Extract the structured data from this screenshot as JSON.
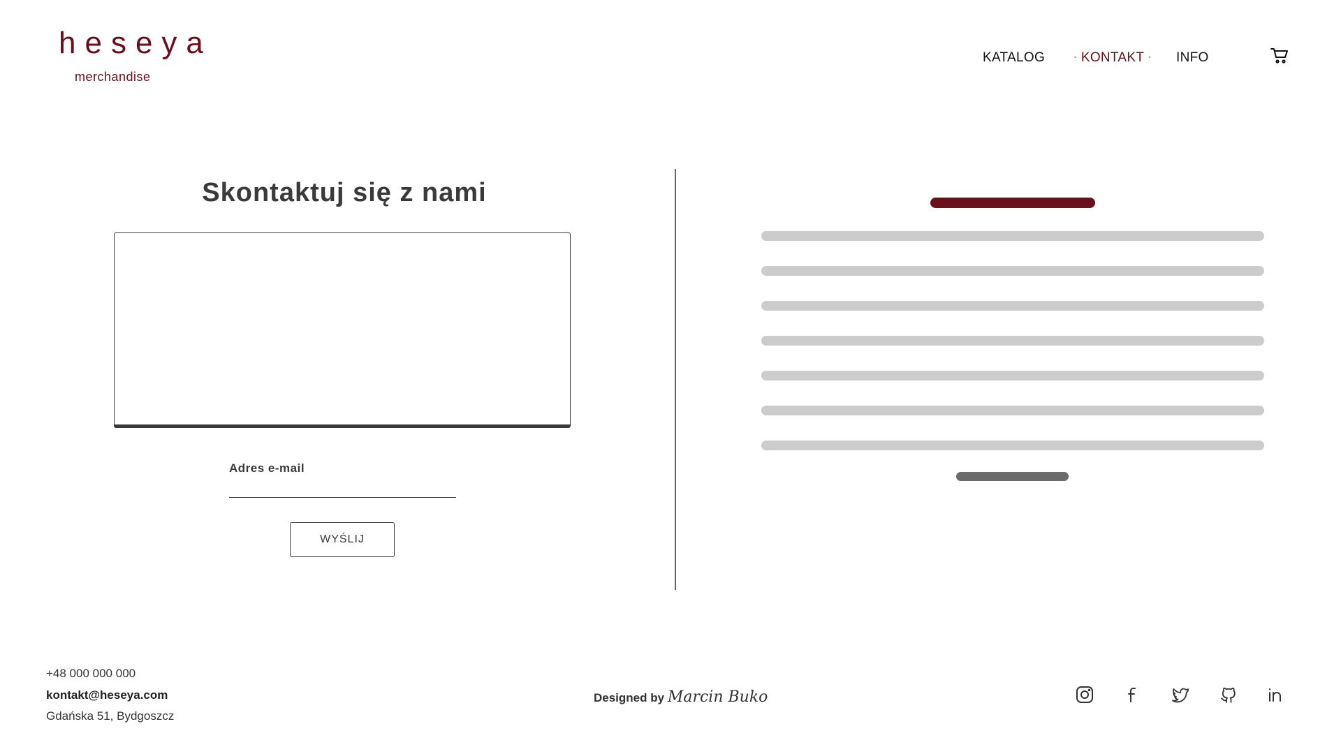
{
  "header": {
    "logo_word": "heseya",
    "logo_sub": "merchandise",
    "nav": {
      "katalog": "KATALOG",
      "kontakt": "KONTAKT",
      "info": "INFO"
    }
  },
  "contact": {
    "title": "Skontaktuj się z nami",
    "email_label": "Adres e-mail",
    "send_label": "WYŚLIJ"
  },
  "footer": {
    "phone": "+48 000 000 000",
    "email": "kontakt@heseya.com",
    "address": "Gdańska 51, Bydgoszcz",
    "designed_by": "Designed by",
    "designer": "Marcin Buko"
  },
  "icons": {
    "cart": "cart-icon",
    "social": [
      "instagram-icon",
      "facebook-icon",
      "twitter-icon",
      "github-icon",
      "linkedin-icon"
    ]
  },
  "colors": {
    "brand": "#6b0f1a",
    "skeleton": "#cccccc",
    "skeleton_dark": "#6b6b6b"
  }
}
